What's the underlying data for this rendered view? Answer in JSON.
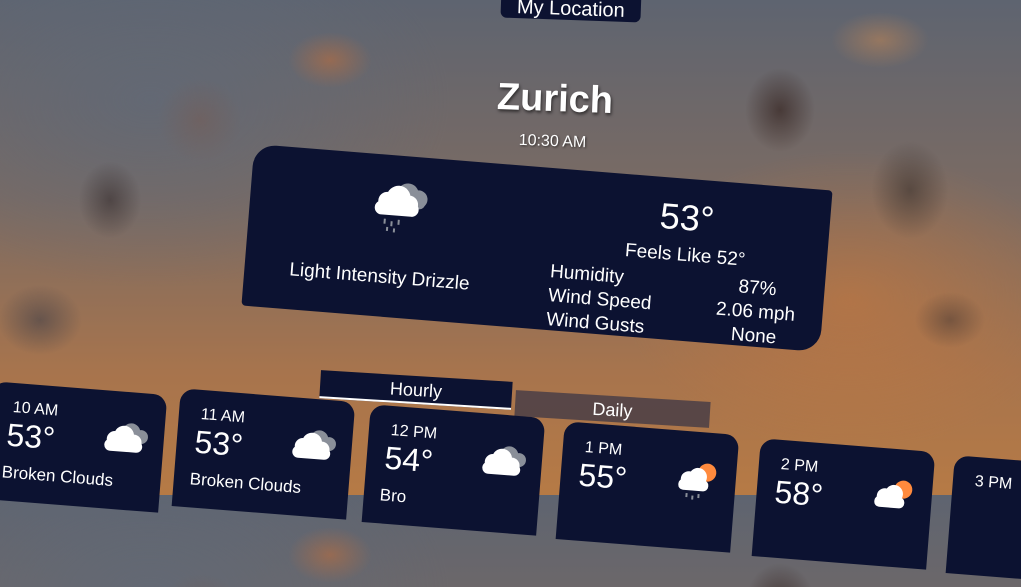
{
  "header": {
    "location_tab": "My Location",
    "city": "Zurich",
    "time": "10:30 AM"
  },
  "current": {
    "condition": "Light Intensity Drizzle",
    "icon": "drizzle-cloud-icon",
    "temperature": "53°",
    "feels_like": "Feels Like 52°",
    "stats": [
      {
        "label": "Humidity",
        "value": "87%"
      },
      {
        "label": "Wind Speed",
        "value": "2.06 mph"
      },
      {
        "label": "Wind Gusts",
        "value": "None"
      }
    ]
  },
  "tabs": {
    "hourly": "Hourly",
    "daily": "Daily",
    "active": "Hourly"
  },
  "hourly": [
    {
      "time": "10 AM",
      "temp": "53°",
      "condition": "Broken Clouds",
      "icon": "broken-clouds-icon"
    },
    {
      "time": "11 AM",
      "temp": "53°",
      "condition": "Broken Clouds",
      "icon": "broken-clouds-icon"
    },
    {
      "time": "12 PM",
      "temp": "54°",
      "condition": "Bro",
      "icon": "broken-clouds-icon"
    },
    {
      "time": "1 PM",
      "temp": "55°",
      "condition": "",
      "icon": "sun-rain-cloud-icon"
    },
    {
      "time": "2 PM",
      "temp": "58°",
      "condition": "",
      "icon": "sun-cloud-icon"
    },
    {
      "time": "3 PM",
      "temp": "",
      "condition": "",
      "icon": ""
    }
  ],
  "colors": {
    "panel": "#0c1231",
    "sun": "#ff8a3d",
    "cloud": "#ffffff"
  }
}
